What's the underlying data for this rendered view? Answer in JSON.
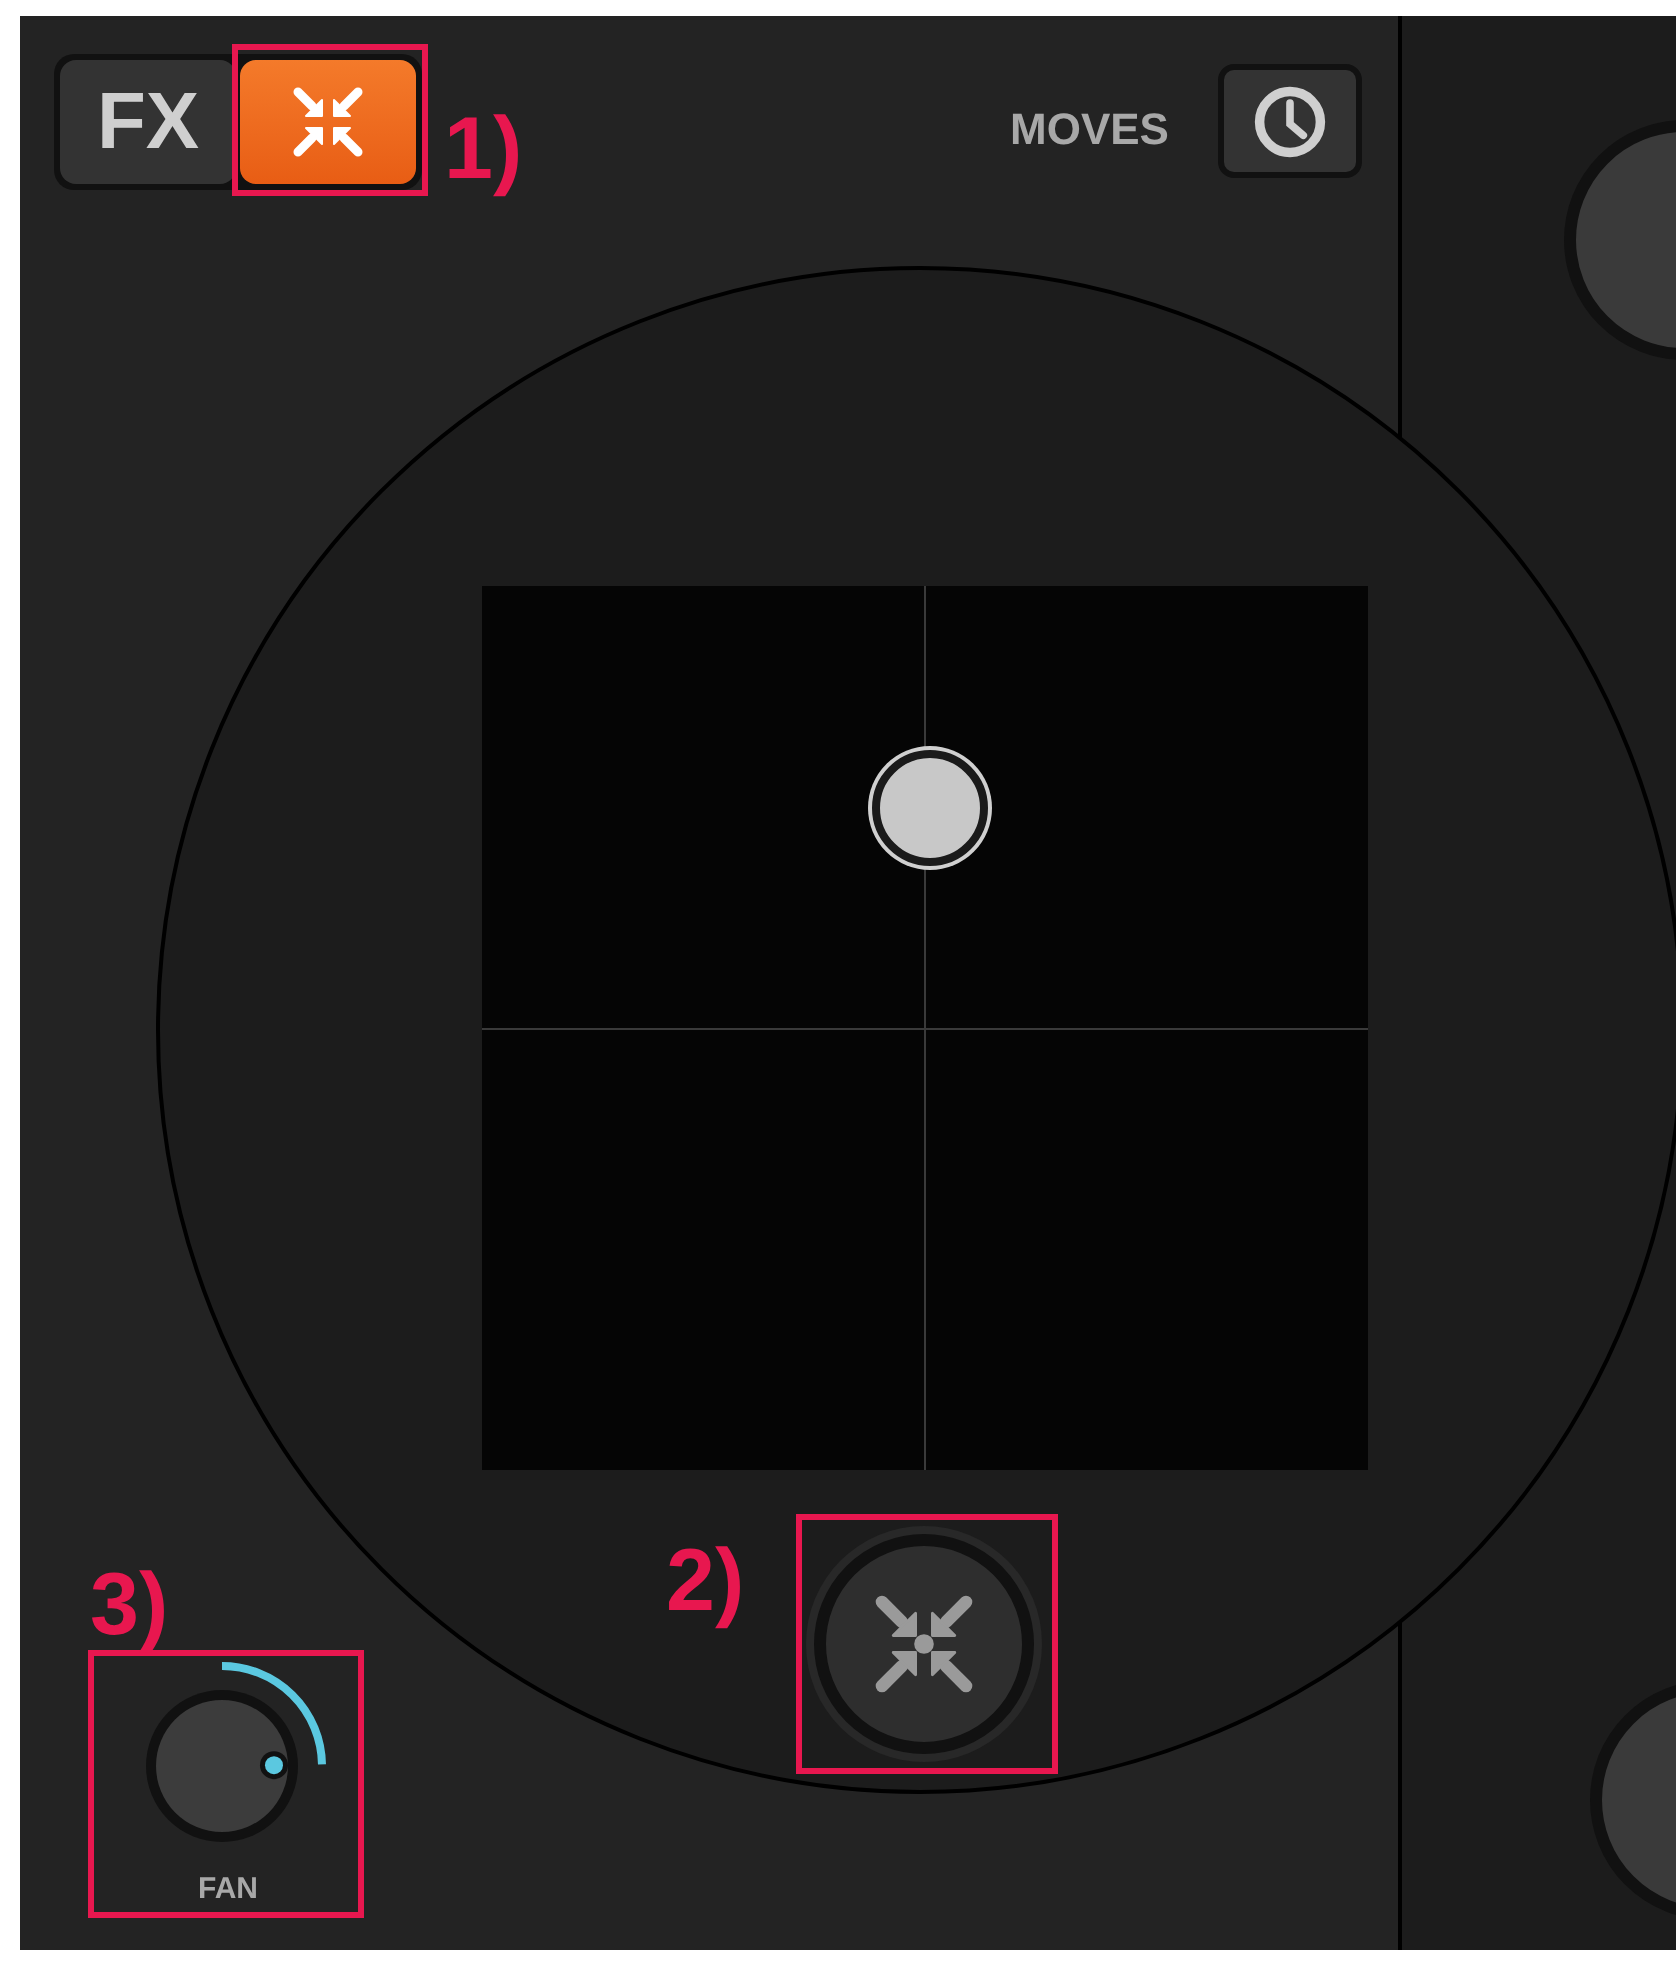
{
  "mode_tabs": [
    {
      "kind": "text",
      "label": "FX",
      "selected": false
    },
    {
      "kind": "icon",
      "selected": true
    }
  ],
  "moves": {
    "label": "MOVES"
  },
  "knob": {
    "label": "FAN",
    "level": 0.83
  },
  "annotations": [
    {
      "kind": "tabs",
      "label": "1)"
    },
    {
      "kind": "button",
      "label": "2)"
    },
    {
      "kind": "knob",
      "label": "3)"
    }
  ]
}
